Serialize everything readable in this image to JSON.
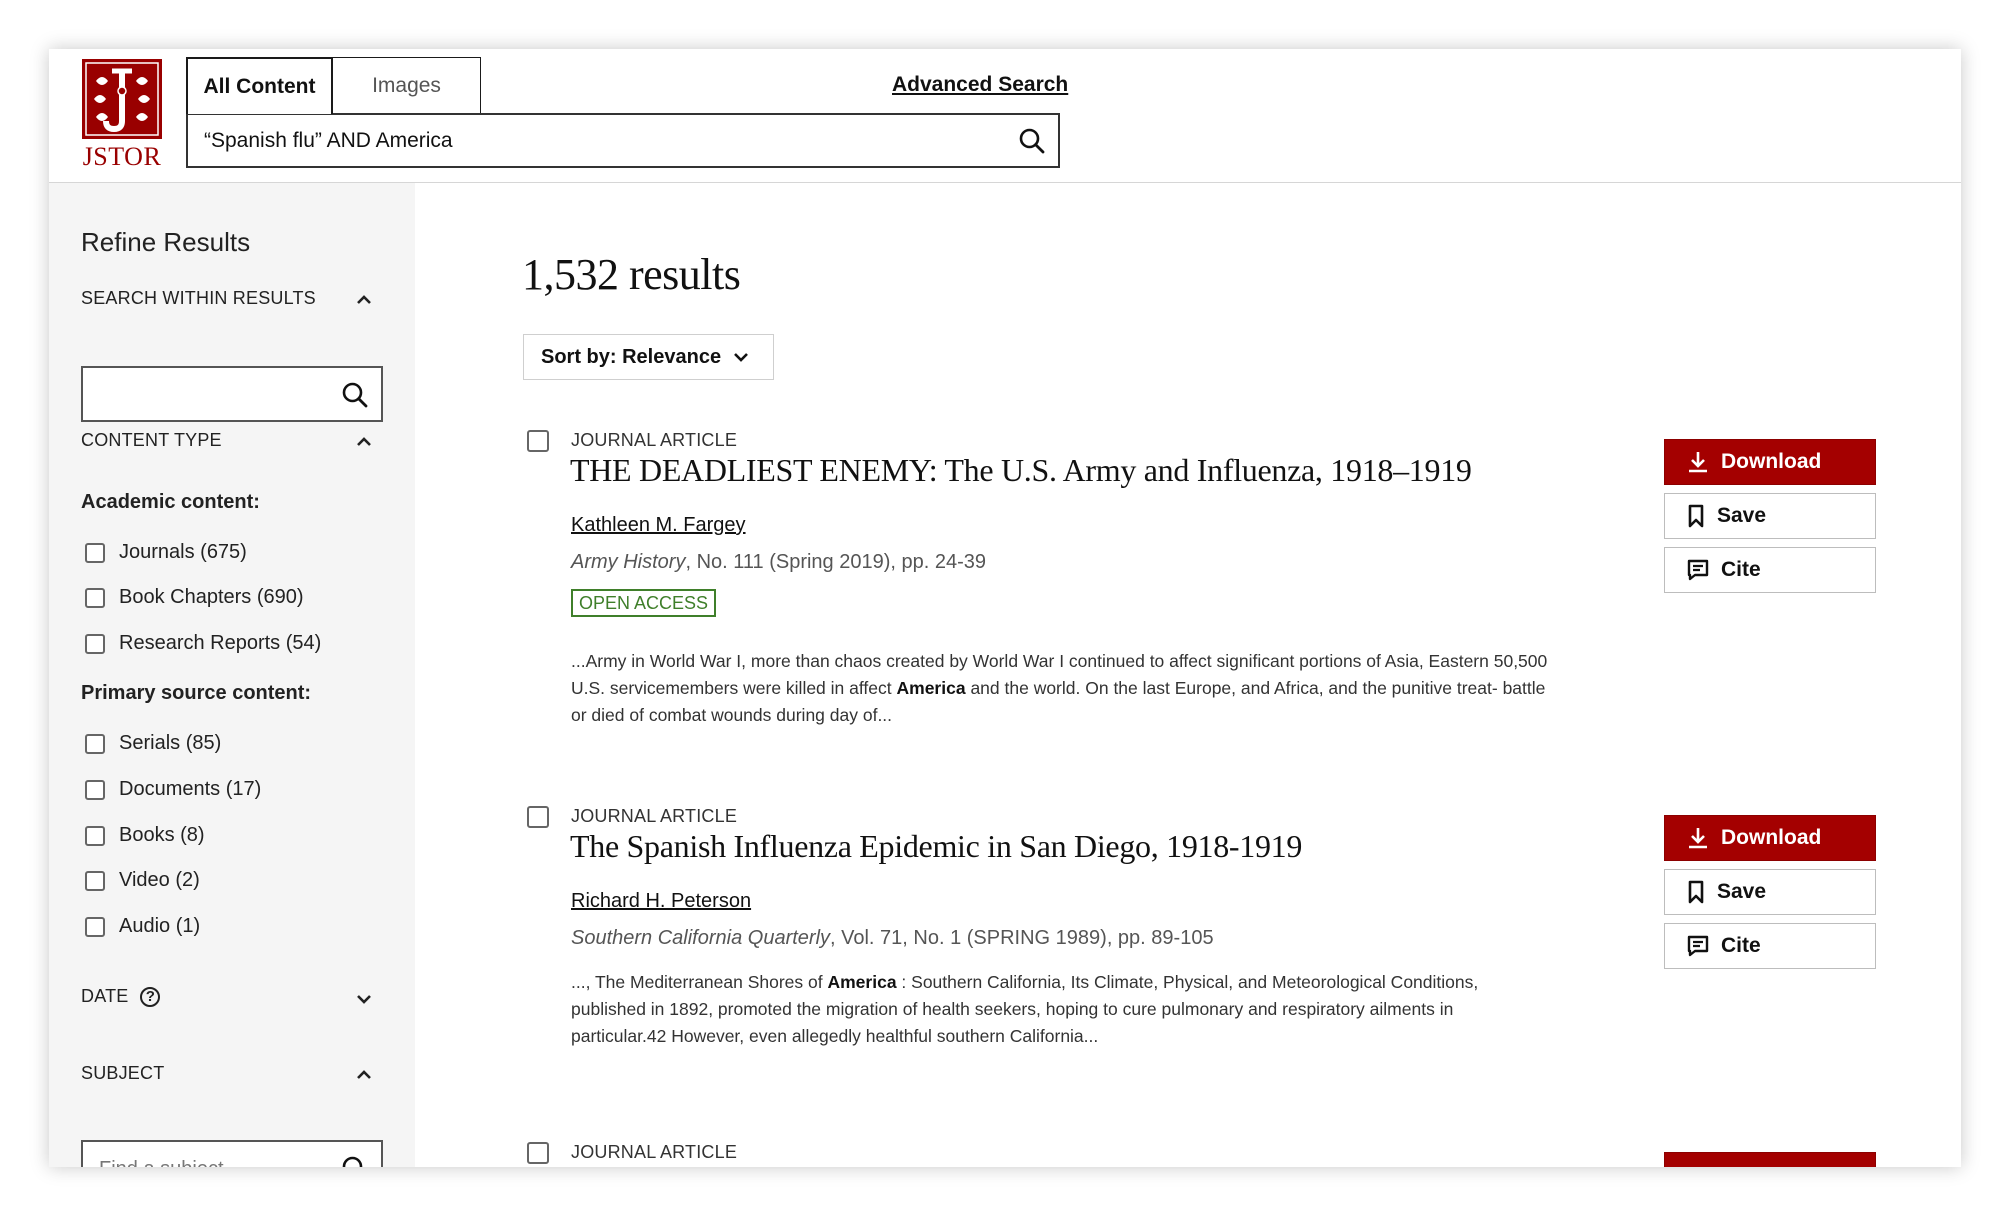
{
  "brand": {
    "name": "JSTOR",
    "color": "#990000"
  },
  "header": {
    "tabs": [
      {
        "label": "All Content",
        "active": true
      },
      {
        "label": "Images",
        "active": false
      }
    ],
    "advanced_search": "Advanced Search",
    "search_query": "“Spanish flu” AND America",
    "search_icon": "search-icon"
  },
  "sidebar": {
    "title": "Refine Results",
    "search_within": {
      "heading": "SEARCH WITHIN RESULTS",
      "value": ""
    },
    "content_type": {
      "heading": "CONTENT TYPE",
      "academic_label": "Academic content:",
      "academic": [
        {
          "label": "Journals (675)"
        },
        {
          "label": "Book Chapters (690)"
        },
        {
          "label": "Research Reports (54)"
        }
      ],
      "primary_label": "Primary source content:",
      "primary": [
        {
          "label": "Serials (85)"
        },
        {
          "label": "Documents (17)"
        },
        {
          "label": "Books (8)"
        },
        {
          "label": "Video (2)"
        },
        {
          "label": "Audio (1)"
        }
      ]
    },
    "date": {
      "heading": "DATE",
      "help": "?"
    },
    "subject": {
      "heading": "SUBJECT",
      "placeholder": "Find a subject"
    }
  },
  "main": {
    "results_count": "1,532 results",
    "sort_label": "Sort by: Relevance",
    "results": [
      {
        "type": "JOURNAL ARTICLE",
        "title": "THE DEADLIEST ENEMY: The U.S. Army and Influenza, 1918–1919",
        "author": "Kathleen M. Fargey",
        "source_title": "Army History",
        "source_rest": ", No. 111 (Spring 2019), pp. 24-39",
        "badge": "OPEN ACCESS",
        "snippet_1": "...Army in World War I, more than chaos created by World War I continued to affect significant portions of Asia, Eastern 50,500 U.S. servicemembers were killed in affect ",
        "snippet_bold": "America",
        "snippet_2": " and the world. On the last Europe, and Africa, and the punitive treat- battle or died of combat wounds during day of..."
      },
      {
        "type": "JOURNAL ARTICLE",
        "title": "The Spanish Influenza Epidemic in San Diego, 1918-1919",
        "author": "Richard H. Peterson",
        "source_title": "Southern California Quarterly",
        "source_rest": ", Vol. 71, No. 1 (SPRING 1989), pp. 89-105",
        "snippet_1": "..., The Mediterranean Shores of ",
        "snippet_bold": "America",
        "snippet_2": " : Southern California, Its Climate, Physical, and Meteorological Conditions, published in 1892, promoted the migration of health seekers, hoping to cure pulmonary and respiratory ailments in particular.42 However, even allegedly healthful southern California..."
      },
      {
        "type": "JOURNAL ARTICLE"
      }
    ],
    "actions": {
      "download": "Download",
      "save": "Save",
      "cite": "Cite"
    }
  }
}
